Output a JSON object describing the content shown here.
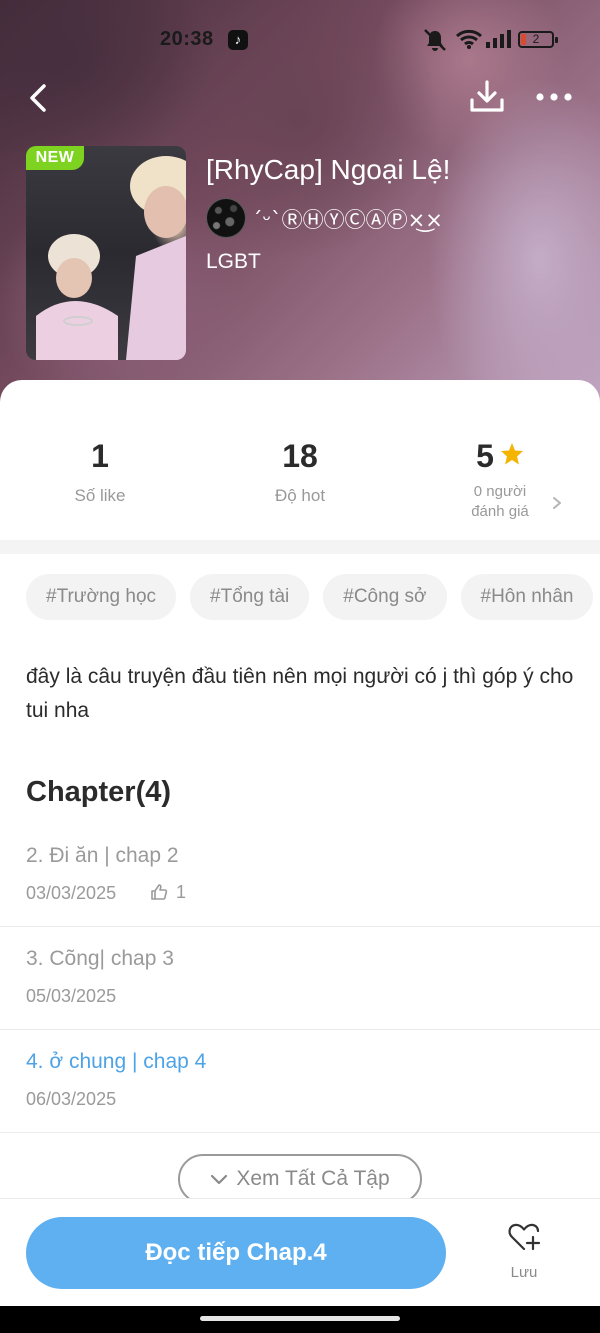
{
  "status_bar": {
    "time": "20:38",
    "battery": "2"
  },
  "story": {
    "badge": "NEW",
    "title": "[RhyCap] Ngoại Lệ!",
    "author": "´ᵕ`ⓇⒽⓎⒸⒶⓅ×͜×",
    "genre": "LGBT"
  },
  "stats": {
    "likes_value": "1",
    "likes_label": "Số like",
    "hot_value": "18",
    "hot_label": "Độ hot",
    "rating_value": "5",
    "rating_line1": "0 người",
    "rating_line2": "đánh giá"
  },
  "tags": [
    "#Trường học",
    "#Tổng tài",
    "#Công sở",
    "#Hôn nhân"
  ],
  "description": "đây là câu truyện đầu tiên nên mọi người có j thì góp ý cho tui nha",
  "chapters": {
    "heading": "Chapter(4)",
    "items": [
      {
        "title": "2. Đi ăn | chap 2",
        "date": "03/03/2025",
        "likes": "1",
        "current": false
      },
      {
        "title": "3. Cõng| chap 3",
        "date": "05/03/2025",
        "current": false
      },
      {
        "title": "4. ở chung | chap 4",
        "date": "06/03/2025",
        "current": true
      }
    ],
    "view_all_label": "Xem Tất Cả Tập"
  },
  "bottom_bar": {
    "read_label": "Đọc tiếp Chap.4",
    "save_label": "Lưu"
  },
  "colors": {
    "accent_blue": "#5fb0f0",
    "current_chapter": "#4da3e6",
    "new_badge": "#7ed321",
    "star": "#f5b400"
  },
  "icons": {
    "back": "chevron-left-icon",
    "download": "download-icon",
    "more": "more-horizontal-icon",
    "star": "star-icon",
    "thumb": "thumbs-up-icon",
    "chevron_down": "chevron-down-icon",
    "heart_plus": "heart-plus-icon"
  }
}
